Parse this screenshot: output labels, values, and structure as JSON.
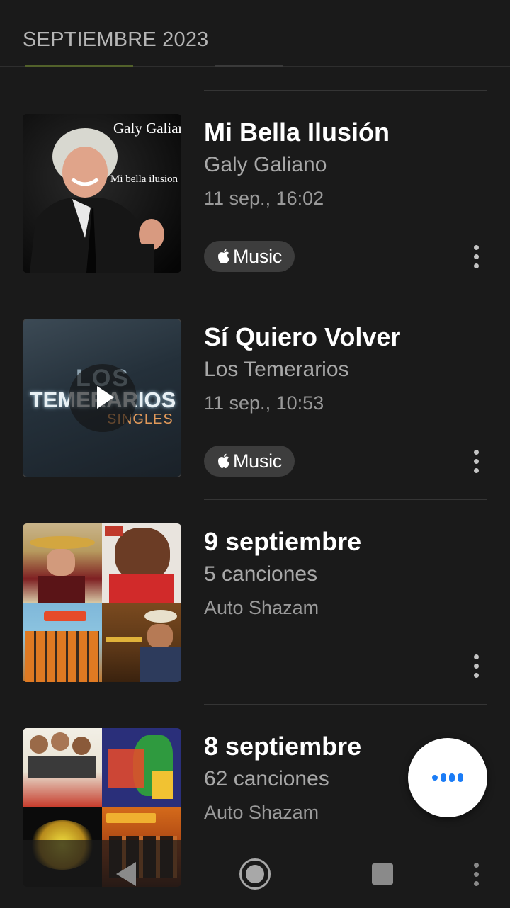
{
  "header": {
    "section_title": "SEPTIEMBRE 2023"
  },
  "items": [
    {
      "title": "Mi Bella Ilusión",
      "subtitle": "Galy Galiano",
      "meta": "11 sep., 16:02",
      "badge": "Music",
      "art_text": {
        "artist": "Galy Galiano",
        "album": "Mi bella ilusion"
      }
    },
    {
      "title": "Sí Quiero Volver",
      "subtitle": "Los Temerarios",
      "meta": "11 sep., 10:53",
      "badge": "Music",
      "art_text": {
        "line1": "LOS",
        "line2": "TEMERARIOS",
        "line3": "SINGLES"
      }
    },
    {
      "title": "9 septiembre",
      "subtitle": "5 canciones",
      "meta": "Auto Shazam"
    },
    {
      "title": "8 septiembre",
      "subtitle": "62 canciones",
      "meta": "Auto Shazam"
    }
  ],
  "colors": {
    "background": "#1a1a1a",
    "accent": "#1b7cf6",
    "badge_bg": "#3d3d3d"
  },
  "icons": {
    "badge": "apple-logo-icon",
    "more": "more-vertical-icon",
    "fab": "shazam-listening-icon",
    "nav": [
      "back-icon",
      "home-icon",
      "recents-icon",
      "more-vertical-icon"
    ]
  }
}
